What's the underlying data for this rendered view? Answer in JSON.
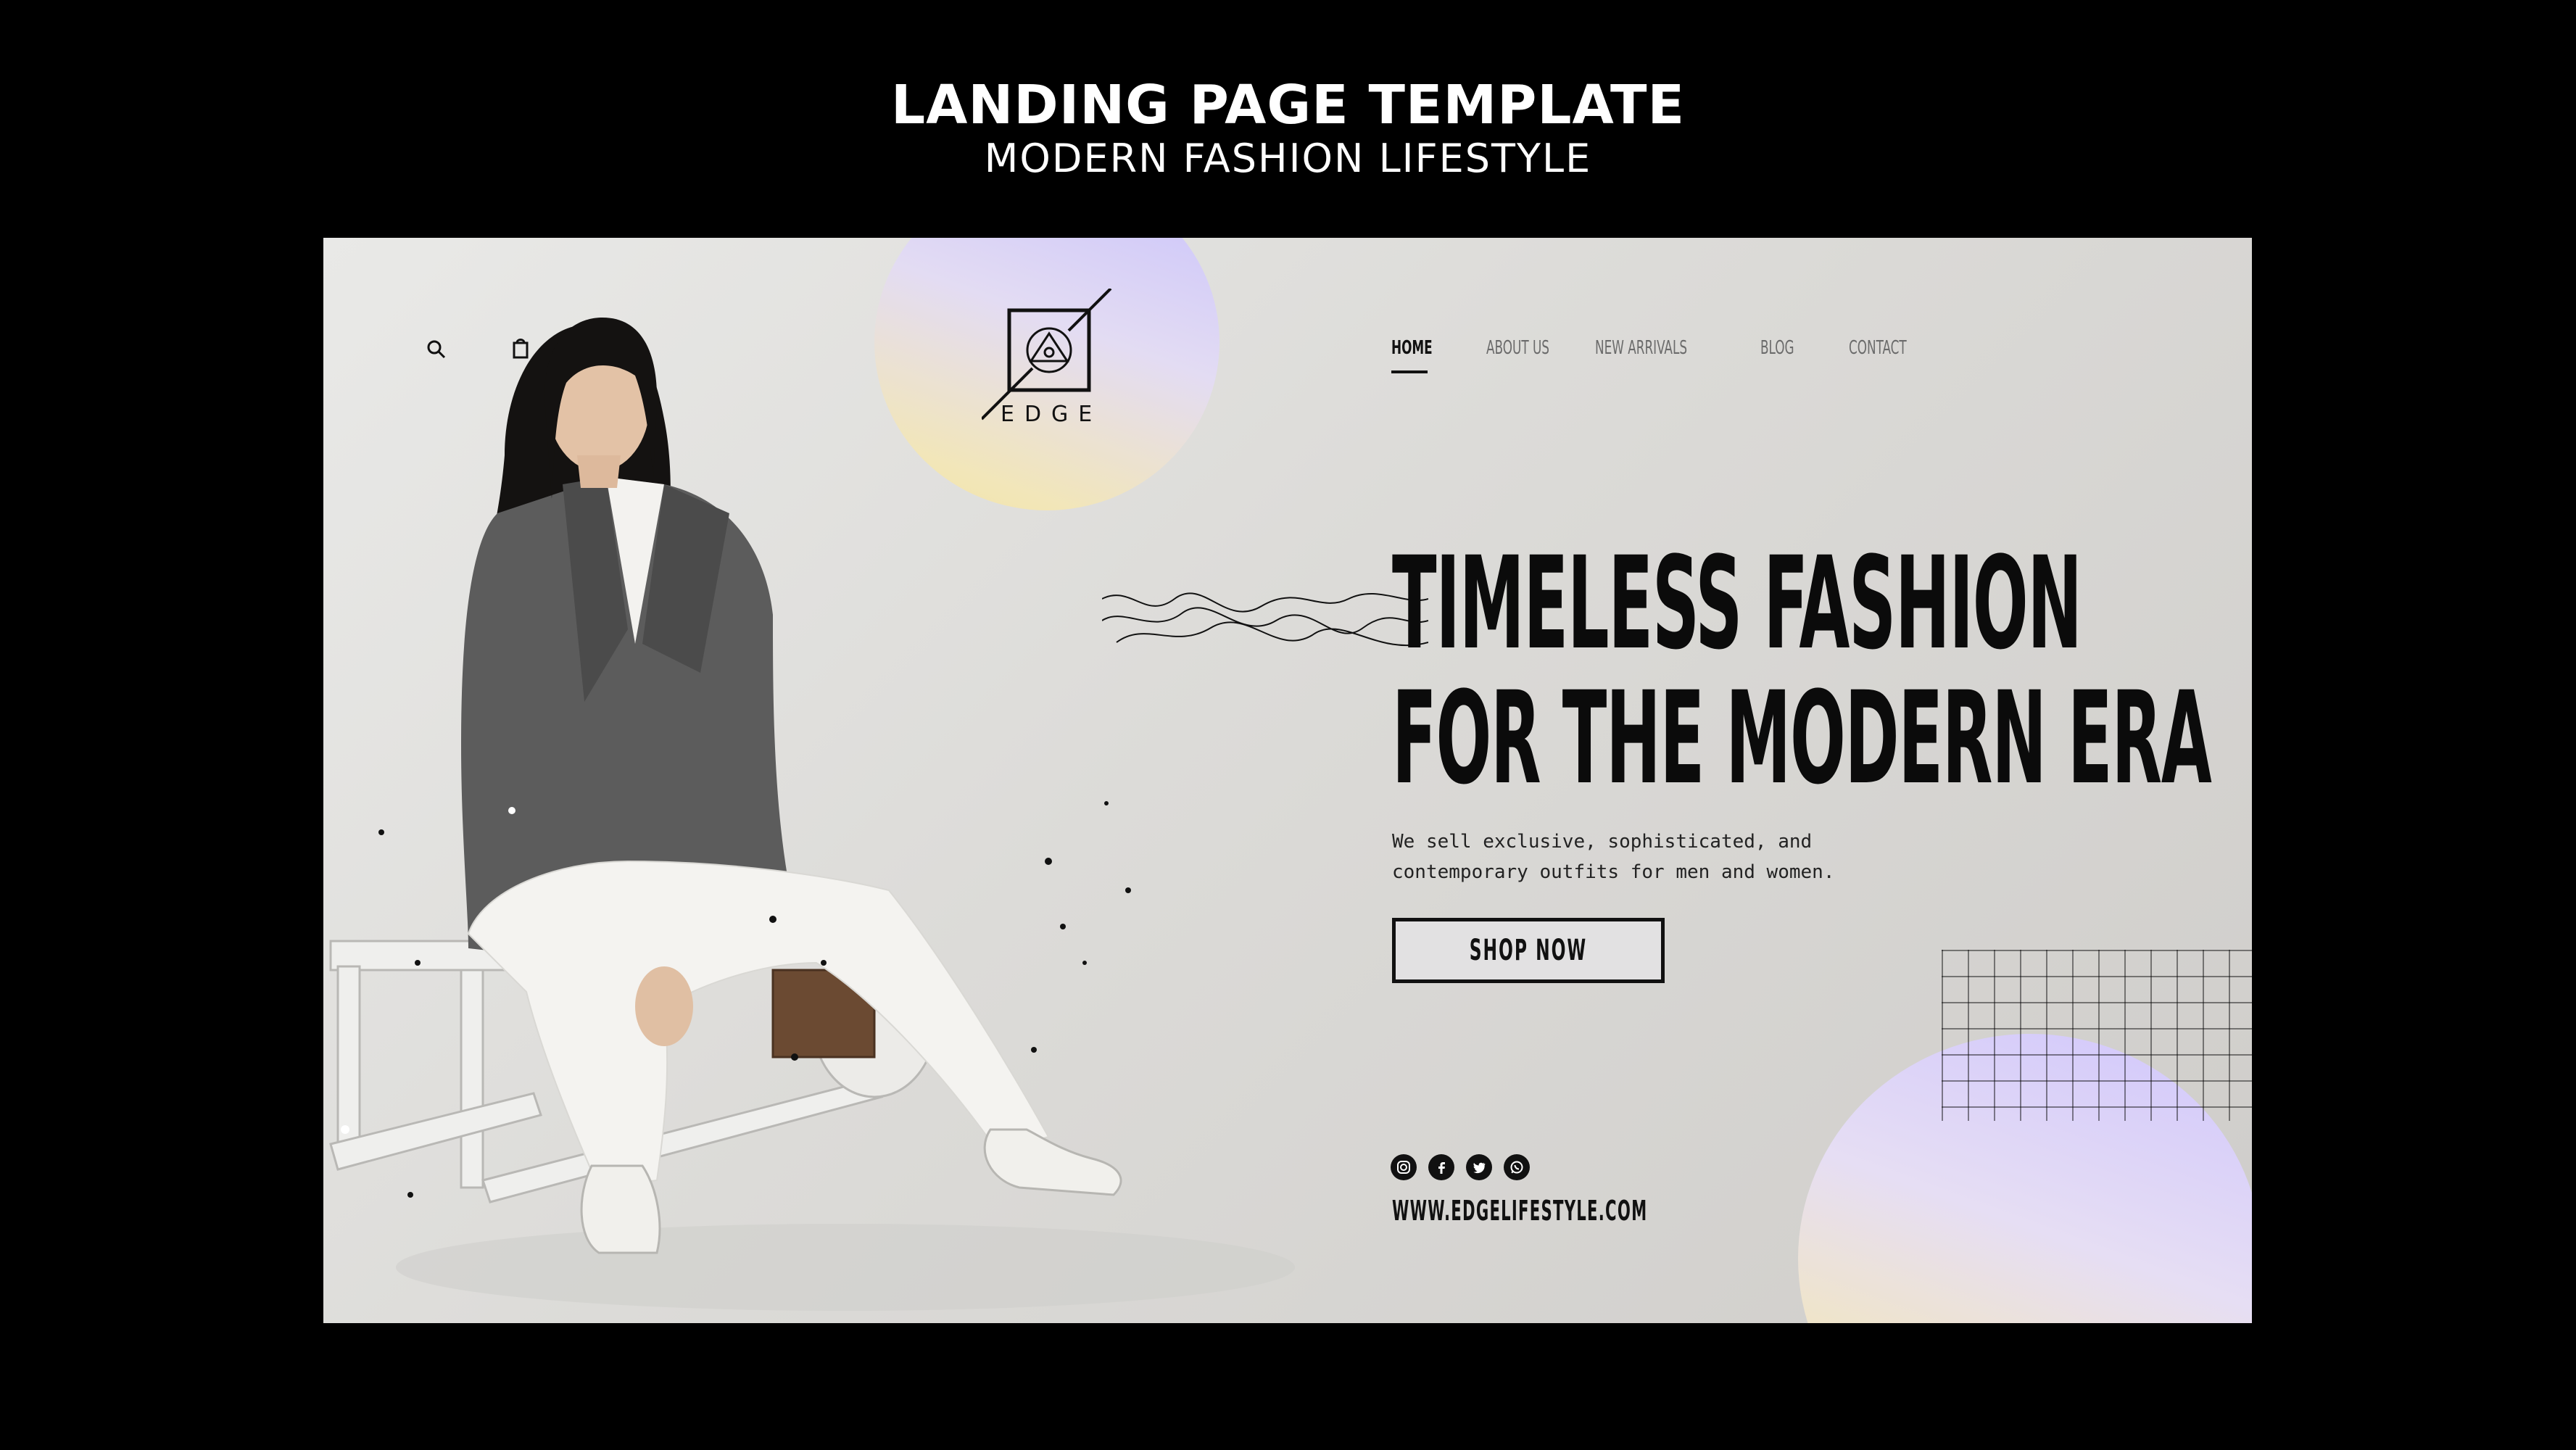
{
  "header": {
    "title": "LANDING PAGE TEMPLATE",
    "subtitle": "MODERN FASHION LIFESTYLE"
  },
  "brand": {
    "logo_text": "EDGE"
  },
  "nav": {
    "items": [
      {
        "label": "HOME",
        "active": true
      },
      {
        "label": "ABOUT US",
        "active": false
      },
      {
        "label": "NEW ARRIVALS",
        "active": false
      },
      {
        "label": "BLOG",
        "active": false
      },
      {
        "label": "CONTACT",
        "active": false
      }
    ]
  },
  "utility_icons": [
    "search-icon",
    "shopping-bag-icon"
  ],
  "hero": {
    "headline_line1": "TIMELESS FASHION",
    "headline_line2": "FOR THE MODERN ERA",
    "description_line1": "We sell exclusive, sophisticated, and",
    "description_line2": "contemporary outfits for men and women.",
    "cta_label": "SHOP NOW"
  },
  "footer": {
    "social_icons": [
      "instagram-icon",
      "facebook-icon",
      "twitter-icon",
      "whatsapp-icon"
    ],
    "website": "WWW.EDGELIFESTYLE.COM"
  },
  "colors": {
    "page_background": "#000000",
    "canvas_background": "#dcdbd8",
    "text": "#0b0b0b",
    "gradient_lavender": "#c9c2fb",
    "gradient_yellow": "#f4e3a7"
  }
}
